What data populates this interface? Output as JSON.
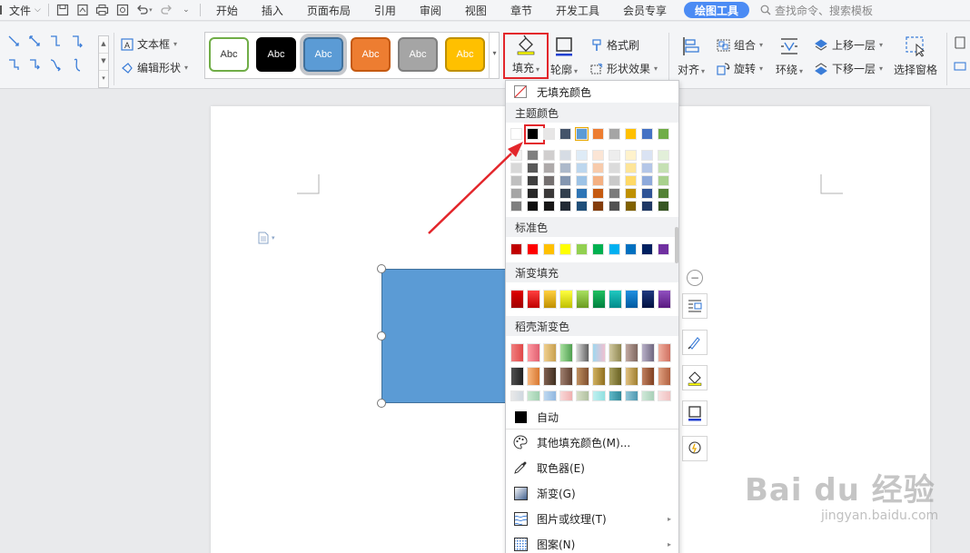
{
  "menubar": {
    "file_label": "文件",
    "tabs": [
      "开始",
      "插入",
      "页面布局",
      "引用",
      "审阅",
      "视图",
      "章节",
      "开发工具",
      "会员专享"
    ],
    "active_tab": "绘图工具",
    "search_placeholder": "查找命令、搜索模板"
  },
  "ribbon": {
    "textbox_label": "文本框",
    "edit_shape_label": "编辑形状",
    "style_swatches": [
      {
        "text": "Abc",
        "fill": "#ffffff",
        "border": "#70ad47",
        "color": "#333333"
      },
      {
        "text": "Abc",
        "fill": "#000000",
        "border": "#000000",
        "color": "#ffffff"
      },
      {
        "text": "Abc",
        "fill": "#5b9bd5",
        "border": "#41719c",
        "color": "#ffffff"
      },
      {
        "text": "Abc",
        "fill": "#ed7d31",
        "border": "#c55a11",
        "color": "#ffffff"
      },
      {
        "text": "Abc",
        "fill": "#a5a5a5",
        "border": "#7f7f7f",
        "color": "#ffffff"
      },
      {
        "text": "Abc",
        "fill": "#ffc000",
        "border": "#bf9000",
        "color": "#ffffff"
      }
    ],
    "fill_label": "填充",
    "outline_label": "轮廓",
    "format_painter_label": "格式刷",
    "shape_effects_label": "形状效果",
    "align_label": "对齐",
    "group_label": "组合",
    "rotate_label": "旋转",
    "bring_forward_label": "上移一层",
    "wrap_label": "环绕",
    "send_backward_label": "下移一层",
    "selection_pane_label": "选择窗格"
  },
  "dropdown": {
    "no_fill_label": "无填充颜色",
    "theme_colors_header": "主题颜色",
    "theme_top_row": [
      "#ffffff",
      "#000000",
      "#e7e6e6",
      "#44546a",
      "#5b9bd5",
      "#ed7d31",
      "#a5a5a5",
      "#ffc000",
      "#4472c4",
      "#70ad47"
    ],
    "theme_shades": [
      [
        "#f2f2f2",
        "#7f7f7f",
        "#d0cece",
        "#d6dce4",
        "#deebf6",
        "#fbe5d5",
        "#ededed",
        "#fff2cc",
        "#dae3f3",
        "#e2efd9"
      ],
      [
        "#d8d8d8",
        "#595959",
        "#aeaaaa",
        "#adb9ca",
        "#bdd7ee",
        "#f7cbac",
        "#dbdbdb",
        "#fee599",
        "#b4c6e7",
        "#c5e0b3"
      ],
      [
        "#bfbfbf",
        "#3f3f3f",
        "#757070",
        "#8496b0",
        "#9dc3e6",
        "#f4b183",
        "#c9c9c9",
        "#ffd966",
        "#8eaadb",
        "#a8d08d"
      ],
      [
        "#a5a5a5",
        "#262626",
        "#3a3838",
        "#323f4f",
        "#2e75b5",
        "#c55a11",
        "#7b7b7b",
        "#bf9000",
        "#2f5496",
        "#538135"
      ],
      [
        "#7f7f7f",
        "#0c0c0c",
        "#171616",
        "#222a35",
        "#1e4e79",
        "#833c0b",
        "#525252",
        "#7f6000",
        "#1f3864",
        "#375623"
      ]
    ],
    "standard_colors_header": "标准色",
    "standard_colors": [
      "#c00000",
      "#ff0000",
      "#ffc000",
      "#ffff00",
      "#92d050",
      "#00b050",
      "#00b0f0",
      "#0070c0",
      "#002060",
      "#7030a0"
    ],
    "gradient_fill_header": "渐变填充",
    "gradient_colors": [
      [
        "#e00000",
        "#a00000"
      ],
      [
        "#ff4040",
        "#c00000"
      ],
      [
        "#ffd040",
        "#c09000"
      ],
      [
        "#ffff40",
        "#c0c000"
      ],
      [
        "#a8e060",
        "#6a9a20"
      ],
      [
        "#20c060",
        "#008040"
      ],
      [
        "#20c8c0",
        "#008a8a"
      ],
      [
        "#2090e0",
        "#005aa0"
      ],
      [
        "#203880",
        "#001040"
      ],
      [
        "#9050c0",
        "#5a1a80"
      ]
    ],
    "daoke_gradient_header": "稻壳渐变色",
    "daoke_rows": [
      [
        [
          "#f08080",
          "#e04848"
        ],
        [
          "#ff9aa2",
          "#e06070"
        ],
        [
          "#f0d090",
          "#c8a050"
        ],
        [
          "#a8e0a0",
          "#50a050"
        ],
        [
          "#d8d8d8",
          "#606060"
        ],
        [
          "#a0d8f0",
          "#f0c0d0"
        ],
        [
          "#d0c8a0",
          "#908850"
        ],
        [
          "#c0a8a0",
          "#806860"
        ],
        [
          "#b8b0c8",
          "#706880"
        ],
        [
          "#f0b0a0",
          "#d07060"
        ]
      ],
      [
        [
          "#505050",
          "#202020"
        ],
        [
          "#f8b880",
          "#d87830"
        ],
        [
          "#806050",
          "#403020"
        ],
        [
          "#a08070",
          "#604030"
        ],
        [
          "#c09060",
          "#805030"
        ],
        [
          "#d0b060",
          "#907020"
        ],
        [
          "#a8a060",
          "#686020"
        ],
        [
          "#e0c080",
          "#a08030"
        ],
        [
          "#c08060",
          "#804020"
        ],
        [
          "#e0a080",
          "#b06040"
        ]
      ],
      [
        [
          "#e8e8e8",
          "#d0d8e0"
        ],
        [
          "#c8e8d0",
          "#a0d0b0"
        ],
        [
          "#c0d8f0",
          "#90b8e0"
        ],
        [
          "#f8d8d8",
          "#f0b0b0"
        ],
        [
          "#d8e0c8",
          "#b0c0a0"
        ],
        [
          "#c0f0f0",
          "#90e0e0"
        ],
        [
          "#60b8c8",
          "#308898"
        ],
        [
          "#90c8d8",
          "#5098b0"
        ],
        [
          "#d0e8d8",
          "#a8d0b8"
        ],
        [
          "#f8e0e0",
          "#f0c0c0"
        ]
      ]
    ],
    "auto_label": "自动",
    "more_fill_label": "其他填充颜色(M)...",
    "eyedropper_label": "取色器(E)",
    "gradient_label": "渐变(G)",
    "picture_texture_label": "图片或纹理(T)",
    "pattern_label": "图案(N)"
  },
  "watermark": {
    "brand": "Bai du 经验",
    "url": "jingyan.baidu.com"
  },
  "colors": {
    "accent": "#4b8bf4",
    "highlight_red": "#e3262b",
    "shape_fill": "#5b9bd5"
  }
}
